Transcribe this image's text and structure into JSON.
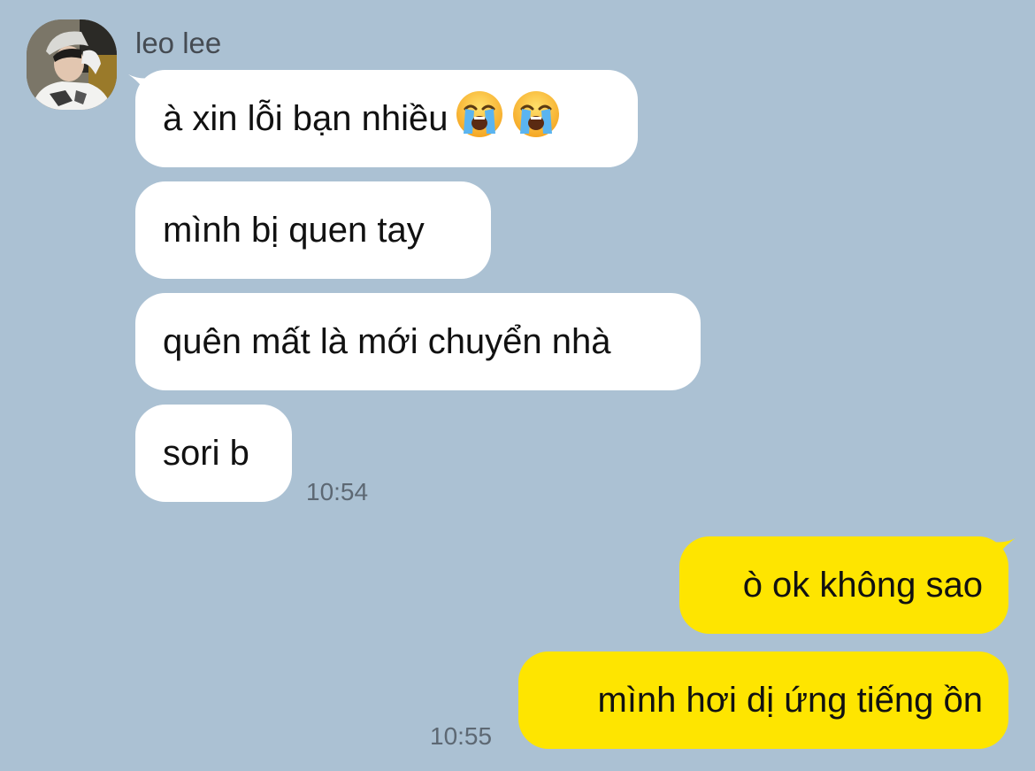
{
  "contact": {
    "name": "leo lee",
    "avatar_icon": "profile-photo"
  },
  "incoming": {
    "messages": [
      {
        "text": "à xin lỗi bạn nhiều",
        "emoji": [
          "loudly-crying-face",
          "loudly-crying-face"
        ]
      },
      {
        "text": "mình bị quen tay"
      },
      {
        "text": "quên mất là mới chuyển nhà"
      },
      {
        "text": "sori b"
      }
    ],
    "time": "10:54"
  },
  "outgoing": {
    "messages": [
      {
        "text": "ò ok không sao"
      },
      {
        "text": "mình hơi dị ứng tiếng ồn"
      }
    ],
    "time": "10:55"
  },
  "colors": {
    "background": "#abc1d3",
    "incoming_bubble": "#ffffff",
    "outgoing_bubble": "#fee500",
    "timestamp": "#5d6873"
  }
}
